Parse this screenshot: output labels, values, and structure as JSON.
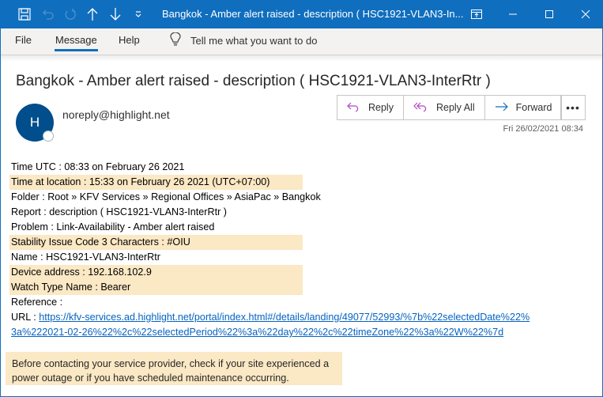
{
  "window": {
    "title": "Bangkok - Amber alert raised - description ( HSC1921-VLAN3-In...",
    "accent_color": "#106ebe",
    "quick_access": [
      {
        "icon": "save-icon"
      },
      {
        "icon": "undo-icon",
        "disabled": true
      },
      {
        "icon": "redo-icon",
        "disabled": true
      },
      {
        "icon": "previous-item-icon"
      },
      {
        "icon": "next-item-icon"
      },
      {
        "icon": "customize-quick-access-icon"
      }
    ],
    "controls": [
      "ribbon-display-options-icon",
      "minimize-icon",
      "maximize-icon",
      "close-icon"
    ]
  },
  "ribbon": {
    "tabs": [
      {
        "label": "File",
        "active": false
      },
      {
        "label": "Message",
        "active": true
      },
      {
        "label": "Help",
        "active": false
      }
    ],
    "tell_me": "Tell me what you want to do"
  },
  "message": {
    "subject": "Bangkok - Amber alert raised - description ( HSC1921-VLAN3-InterRtr )",
    "avatar_initial": "H",
    "sender": "noreply@highlight.net",
    "date": "Fri 26/02/2021 08:34",
    "actions": {
      "reply": "Reply",
      "reply_all": "Reply All",
      "forward": "Forward",
      "more": "•••"
    }
  },
  "body": {
    "lines": [
      {
        "text": "Time UTC : 08:33 on February 26 2021",
        "highlight": false
      },
      {
        "text": "Time at location : 15:33 on February 26 2021  (UTC+07:00)",
        "highlight": true
      },
      {
        "text": "Folder : Root » KFV Services » Regional Offices » AsiaPac » Bangkok",
        "highlight": false
      },
      {
        "text": "Report : description ( HSC1921-VLAN3-InterRtr )",
        "highlight": false
      },
      {
        "text": "Problem : Link-Availability - Amber alert raised",
        "highlight": false
      },
      {
        "text": "Stability Issue Code 3 Characters : #OIU",
        "highlight": true
      },
      {
        "text": "Name : HSC1921-VLAN3-InterRtr",
        "highlight": false
      },
      {
        "text": "Device address : 192.168.102.9",
        "highlight": true
      },
      {
        "text": "Watch Type Name : Bearer",
        "highlight": true
      },
      {
        "text": "Reference :",
        "highlight": false
      }
    ],
    "url_label": "URL : ",
    "url_line1": "https://kfv-services.ad.highlight.net/portal/index.html#/details/landing/49077/52993/%7b%22selectedDate%22%",
    "url_line2": "3a%222021-02-26%22%2c%22selectedPeriod%22%3a%22day%22%2c%22timeZone%22%3a%22W%22%7d",
    "note": "Before contacting your service provider, check if your site experienced a power outage or if you have scheduled maintenance occurring.",
    "highlight_color": "#fbe8c4",
    "link_color": "#0563c1"
  }
}
